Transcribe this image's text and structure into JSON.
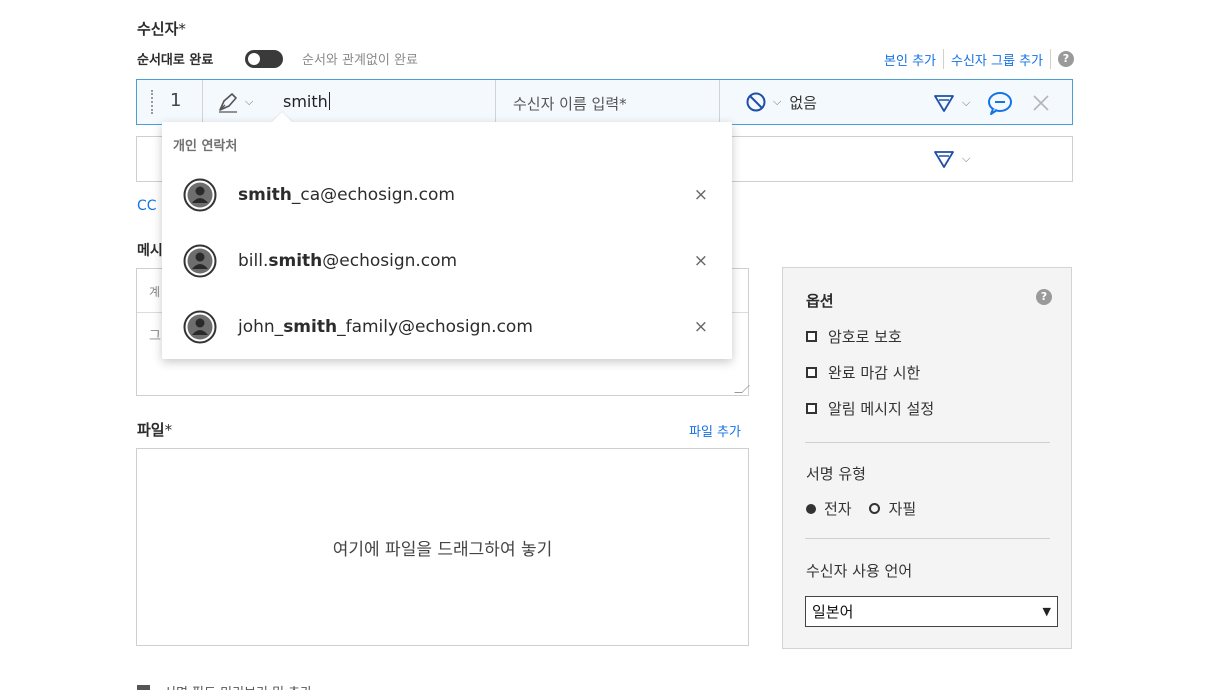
{
  "recipients": {
    "title": "수신자",
    "required_mark": "*",
    "order_label": "순서대로 완료",
    "order_any_label": "순서와 관계없이 완료",
    "add_me_label": "본인 추가",
    "add_group_label": "수신자 그룹 추가",
    "help_glyph": "?",
    "rows": [
      {
        "number": "1",
        "email_value": "smith",
        "name_placeholder": "수신자 이름 입력*",
        "auth_value": "없음"
      }
    ],
    "cc_label": "CC"
  },
  "autocomplete": {
    "header": "개인 연락처",
    "items": [
      {
        "prefix": "",
        "match": "smith",
        "suffix": "_ca@echosign.com",
        "remove": "×"
      },
      {
        "prefix": "bill.",
        "match": "smith",
        "suffix": "@echosign.com",
        "remove": "×"
      },
      {
        "prefix": "john_",
        "match": "smith",
        "suffix": "_family@echosign.com",
        "remove": "×"
      }
    ]
  },
  "message": {
    "label_partial": "메시",
    "subject_partial": "계",
    "body_partial": "그"
  },
  "files": {
    "label": "파일",
    "required_mark": "*",
    "add_label": "파일 추가",
    "drop_text": "여기에 파일을 드래그하여 놓기"
  },
  "options": {
    "title": "옵션",
    "help_glyph": "?",
    "items": [
      "암호로 보호",
      "완료 마감 시한",
      "알림 메시지 설정"
    ],
    "signature_type_title": "서명 유형",
    "signature_electronic": "전자",
    "signature_handwritten": "자필",
    "language_title": "수신자 사용 언어",
    "language_value": "일본어"
  },
  "bottom": {
    "label_partial": "서명 필드 미리보기 및 추가"
  },
  "colors": {
    "link": "#1473e6",
    "active_border": "#4b9fd5",
    "accent_blue": "#1473e6"
  }
}
